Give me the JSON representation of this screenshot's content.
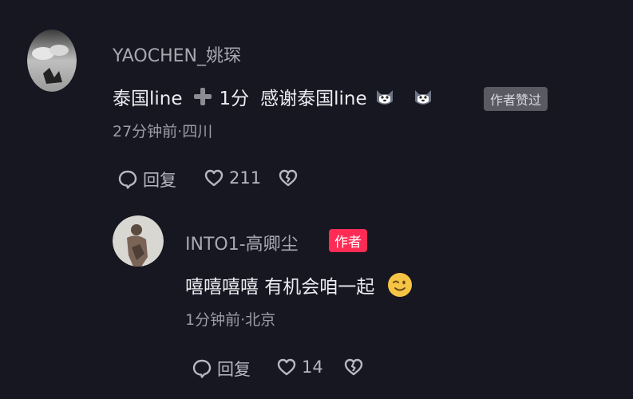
{
  "comment": {
    "username": "YAOCHEN_姚琛",
    "text_part1": "泰国line",
    "text_part2": "1分",
    "text_part3": "感谢泰国line",
    "icons": [
      "plus-icon",
      "cat-emoji-icon",
      "cat-emoji-icon"
    ],
    "liked_by_author_label": "作者赞过",
    "meta": "27分钟前·四川",
    "reply_label": "回复",
    "like_count": "211"
  },
  "reply": {
    "username": "INTO1-高卿尘",
    "author_badge": "作者",
    "text": "嘻嘻嘻嘻 有机会咱一起",
    "icons": [
      "wink-emoji-icon"
    ],
    "meta": "1分钟前·北京",
    "reply_label": "回复",
    "like_count": "14"
  },
  "colors": {
    "background": "#161720",
    "author_badge": "#fe2c55",
    "liked_badge_bg": "#5a5b62"
  }
}
